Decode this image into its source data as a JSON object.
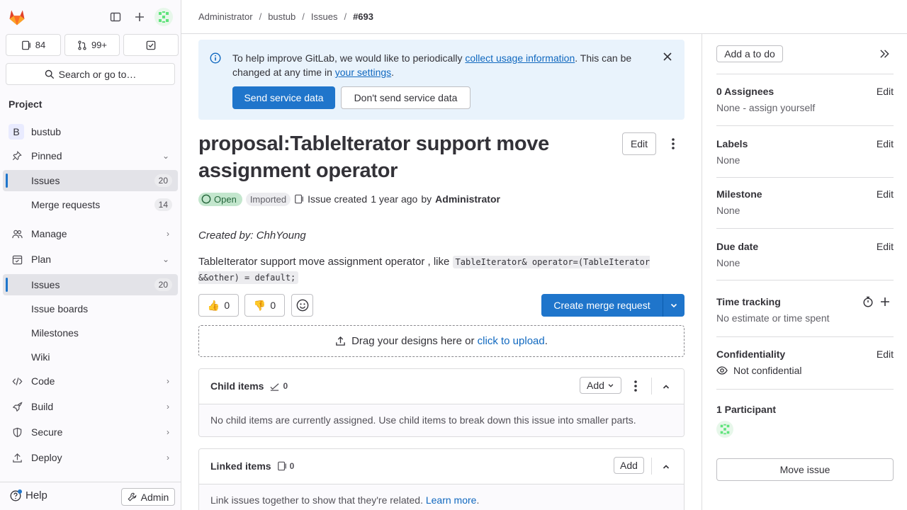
{
  "sidebar": {
    "counts": {
      "issues": "84",
      "merge_requests": "99+"
    },
    "search_label": "Search or go to…",
    "section_title": "Project",
    "project_initial": "B",
    "project_name": "bustub",
    "pinned": {
      "label": "Pinned",
      "items": [
        {
          "label": "Issues",
          "count": "20"
        },
        {
          "label": "Merge requests",
          "count": "14"
        }
      ]
    },
    "manage": "Manage",
    "plan": {
      "label": "Plan",
      "items": [
        {
          "label": "Issues",
          "count": "20"
        },
        {
          "label": "Issue boards"
        },
        {
          "label": "Milestones"
        },
        {
          "label": "Wiki"
        }
      ]
    },
    "code": "Code",
    "build": "Build",
    "secure": "Secure",
    "deploy": "Deploy",
    "help": "Help",
    "admin": "Admin"
  },
  "breadcrumb": [
    "Administrator",
    "bustub",
    "Issues",
    "#693"
  ],
  "alert": {
    "text_before": "To help improve GitLab, we would like to periodically ",
    "link1": "collect usage information",
    "text_middle": ". This can be changed at any time in ",
    "link2": "your settings",
    "text_after": ".",
    "send": "Send service data",
    "dont_send": "Don't send service data"
  },
  "issue": {
    "title": "proposal:TableIterator support move assignment operator",
    "edit": "Edit",
    "status": "Open",
    "imported": "Imported",
    "created_text": "Issue created",
    "created_time": "1 year ago",
    "by": "by",
    "author": "Administrator",
    "created_by": "Created by: ChhYoung",
    "desc_text": "TableIterator support move assignment operator , like ",
    "desc_code": "TableIterator& operator=(TableIterator &&other) = default;",
    "thumbs_up": "0",
    "thumbs_down": "0",
    "create_mr": "Create merge request",
    "upload_text": "Drag your designs here or ",
    "upload_link": "click to upload",
    "upload_after": "."
  },
  "child_items": {
    "title": "Child items",
    "count": "0",
    "add": "Add",
    "empty": "No child items are currently assigned. Use child items to break down this issue into smaller parts."
  },
  "linked_items": {
    "title": "Linked items",
    "count": "0",
    "add": "Add",
    "empty": "Link issues together to show that they're related.",
    "learn_more": "Learn more",
    "after": "."
  },
  "right_sidebar": {
    "todo": "Add a to do",
    "assignees": {
      "title": "0 Assignees",
      "edit": "Edit",
      "value": "None - assign yourself"
    },
    "labels": {
      "title": "Labels",
      "edit": "Edit",
      "value": "None"
    },
    "milestone": {
      "title": "Milestone",
      "edit": "Edit",
      "value": "None"
    },
    "due_date": {
      "title": "Due date",
      "edit": "Edit",
      "value": "None"
    },
    "time_tracking": {
      "title": "Time tracking",
      "value": "No estimate or time spent"
    },
    "confidentiality": {
      "title": "Confidentiality",
      "edit": "Edit",
      "value": "Not confidential"
    },
    "participants": {
      "title": "1 Participant"
    },
    "move": "Move issue"
  }
}
